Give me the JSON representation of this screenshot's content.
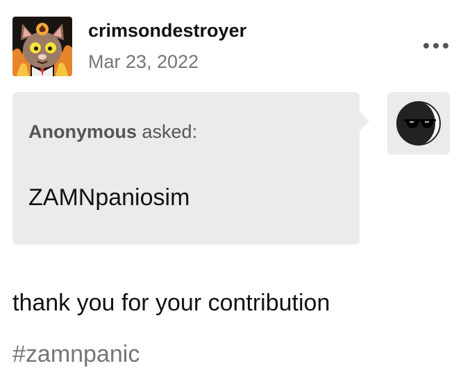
{
  "post": {
    "blog_name": "crimsondestroyer",
    "date": "Mar 23, 2022",
    "avatar_icon": "cat-character-avatar-icon",
    "more_icon": "more-dots-icon"
  },
  "ask": {
    "asker": "Anonymous",
    "asked_suffix": " asked:",
    "question": "ZAMNpaniosim",
    "asker_avatar_icon": "anonymous-sunglasses-avatar-icon"
  },
  "answer": {
    "text": "thank you for your contribution"
  },
  "tags": [
    "#zamnpanic"
  ],
  "colors": {
    "text": "#121212",
    "secondary_text": "#757575",
    "bubble_bg": "#ebebeb",
    "asker_label": "#555555"
  }
}
